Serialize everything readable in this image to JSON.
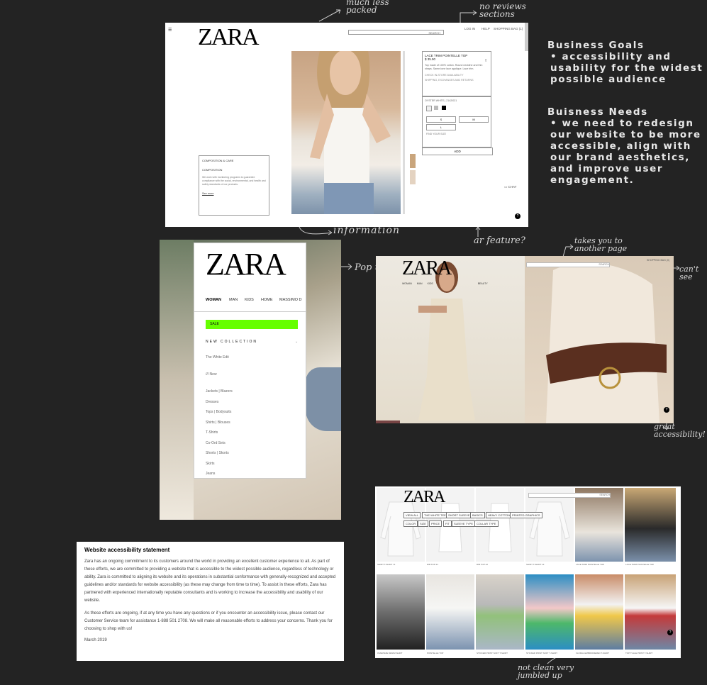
{
  "annotations": {
    "packed": "much less packed",
    "no_reviews": "no reviews sections",
    "information": "information",
    "ar_feature": "ar feature?",
    "pop_up": "Pop up",
    "takes_you": "takes you to another page",
    "cant_see": "can't see",
    "great_accessibility": "great accessibility!",
    "not_clean": "not clean very jumbled up"
  },
  "notes": {
    "goals_title": "Business Goals",
    "goals_item": "• accessibility and usability for the widest possible audience",
    "needs_title": "Buisness Needs",
    "needs_item": "• we need to redesign our website to be more accessible, align with our brand aesthetics, and improve user engagement."
  },
  "product_page": {
    "logo": "ZARA",
    "search": "SEARCH",
    "login": "LOG IN",
    "help": "HELP",
    "bag": "SHOPPING BAG (1)",
    "product_name": "LACE TRIM POINTELLE TOP",
    "price": "$ 35.90",
    "desc": "Top made of 100% cotton. Round neckline and thin straps. Same-tone lace applique. Lace trim.",
    "check_store": "CHECK IN-STORE AVAILABILITY",
    "delivery": "SHIPPING, EXCHANGES AND RETURNS",
    "color_label": "OYSTER WHITE | 2142/021",
    "sizes": [
      "S",
      "M",
      "L"
    ],
    "size_guide": "FIND YOUR SIZE",
    "add": "ADD",
    "chat": "CHAT",
    "composition_title": "COMPOSITION & CARE",
    "composition_sub": "COMPOSITION",
    "composition_text": "We work with monitoring programs to guarantee compliance with the social, environmental, and health and safety standards of our products.",
    "see_more": "See more"
  },
  "menu_page": {
    "logo": "ZARA",
    "tabs": [
      "WOMAN",
      "MAN",
      "KIDS",
      "HOME",
      "MASSIMO D"
    ],
    "sale": "SALE",
    "new_collection": "NEW COLLECTION",
    "items": [
      "The White Edit",
      "/// New",
      "Jackets | Blazers",
      "Dresses",
      "Tops | Bodysuits",
      "Shirts | Blouses",
      "T-Shirts",
      "Co-Ord Sets",
      "Shorts | Skorts",
      "Skirts",
      "Jeans"
    ]
  },
  "home_page": {
    "logo": "ZARA",
    "nav": [
      "WOMAN",
      "MAN",
      "KIDS",
      "BEAUTY"
    ],
    "search": "SEARCH",
    "bag": "SHOPPING BAG (0)"
  },
  "statement": {
    "title": "Website accessibility statement",
    "p1": "Zara has an ongoing commitment to its customers around the world in providing an excellent customer experience to all. As part of these efforts, we are committed to providing a website that is accessible to the widest possible audience, regardless of technology or ability. Zara is committed to aligning its website and its operations in substantial conformance with generally-recognized and accepted guidelines and/or standards for website accessibility (as these may change from time to time). To assist in these efforts, Zara has partnered with experienced internationally reputable consultants and is working to increase the accessibility and usability of our website.",
    "p2": "As these efforts are ongoing, if at any time you have any questions or if you encounter an accessibility issue, please contact our Customer Service team for assistance 1-888 501 2708. We will make all reasonable efforts to address your concerns. Thank you for choosing to shop with us!",
    "date": "March 2019"
  },
  "grid_page": {
    "logo": "ZARA",
    "search": "SEARCH",
    "filters": [
      "VIEW ALL",
      "THE WHITE TEE",
      "SHORT SLEEVE",
      "BASICS",
      "HEAVY COTTON",
      "PRINTED GRAPHICS",
      "COLOR",
      "SIZE",
      "PRICE",
      "FIT",
      "SLEEVE TYPE",
      "COLLAR TYPE"
    ],
    "row1_captions": [
      "SHIRT T-SHIRT 71",
      "RIB TOP 21",
      "RIB TOP 22",
      "SHIRT T-SHIRT 14",
      "LACE TRIM POINTELLE TOP",
      "LACE TRIM POINTELLE TOP"
    ],
    "row2_captions": [
      "OVERSIZE DENIM SHIRT",
      "POINTELLE TOP",
      "STICKER PRINT SOFT T-SHIRT",
      "STICKER PRINT SOFT T-SHIRT",
      "FLORAL EMBROIDERED T-SHIRT",
      "TOP TULLE PRINT T-SHIRT"
    ]
  },
  "colors": {
    "background": "#232323",
    "sale_green": "#66ff00"
  }
}
